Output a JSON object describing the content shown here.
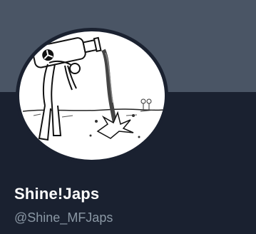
{
  "profile": {
    "display_name": "Shine!Japs",
    "handle": "@Shine_MFJaps",
    "avatar_icon": "cartoon-bottle-pour-icon"
  },
  "colors": {
    "banner": "#4a5565",
    "background": "#1a2130",
    "name_text": "#ffffff",
    "handle_text": "#8b98a5"
  }
}
